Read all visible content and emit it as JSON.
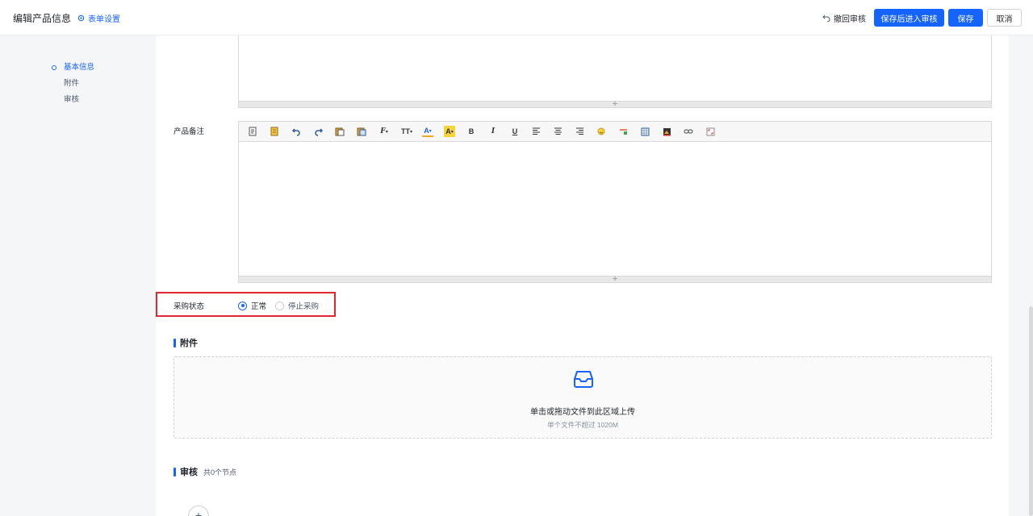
{
  "header": {
    "title": "编辑产品信息",
    "form_settings": "表单设置",
    "withdraw_review": "撤回审核",
    "save_and_review": "保存后进入审核",
    "save": "保存",
    "cancel": "取消"
  },
  "nav": {
    "items": [
      {
        "label": "基本信息",
        "active": true
      },
      {
        "label": "附件",
        "active": false
      },
      {
        "label": "审核",
        "active": false
      }
    ]
  },
  "form": {
    "remark_label": "产品备注",
    "purchase_status": {
      "label": "采购状态",
      "options": [
        {
          "label": "正常",
          "checked": true
        },
        {
          "label": "停止采购",
          "checked": false
        }
      ]
    }
  },
  "toolbar": {
    "icons": [
      "source-icon",
      "template-icon",
      "undo-icon",
      "redo-icon",
      "paste-icon",
      "paste-text-icon",
      "font-family-icon",
      "font-size-icon",
      "font-color-icon",
      "highlight-color-icon",
      "bold-icon",
      "italic-icon",
      "underline-icon",
      "align-left-icon",
      "align-center-icon",
      "align-right-icon",
      "emoji-icon",
      "horizontal-rule-icon",
      "table-icon",
      "image-icon",
      "link-icon",
      "fullscreen-icon"
    ],
    "glyphs": {
      "font_family": "F",
      "font_size": "TT",
      "font_color": "A",
      "highlight": "A",
      "bold": "B",
      "italic": "I",
      "underline": "U"
    }
  },
  "attachments": {
    "title": "附件",
    "upload_text": "单击或拖动文件到此区域上传",
    "upload_hint": "单个文件不超过 1020M"
  },
  "review": {
    "title": "审核",
    "node_count": "共0个节点"
  },
  "colors": {
    "accent": "#1664ff",
    "highlight_border": "#e0282e"
  }
}
